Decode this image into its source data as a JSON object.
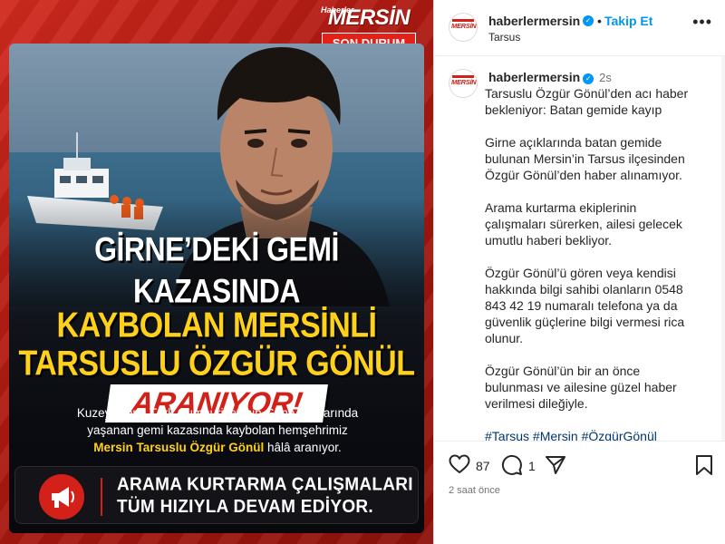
{
  "post_image": {
    "brand_small": "Haberler",
    "brand_name": "MERSİN",
    "brand_badge": "SON DURUM",
    "headline": {
      "line1": "GİRNE’DEKİ GEMİ KAZASINDA",
      "line2": "KAYBOLAN MERSİNLİ",
      "line3": "TARSUSLU ÖZGÜR GÖNÜL",
      "line4": "ARANIYOR!"
    },
    "description": {
      "line1": "Kuzey Kıbrıs Türk Cumhuriyeti’nin Girne açıklarında",
      "line2": "yaşanan gemi kazasında kaybolan hemşehrimiz",
      "highlight": "Mersin Tarsuslu Özgür Gönül",
      "line3_rest": " hâlâ aranıyor."
    },
    "alert": {
      "icon": "megaphone-icon",
      "line1": "ARAMA KURTARMA ÇALIŞMALARI",
      "line2": "TÜM HIZIYLA DEVAM EDİYOR."
    }
  },
  "header": {
    "username": "haberlermersin",
    "follow_label": "Takip Et",
    "location": "Tarsus",
    "separator": "•",
    "avatar_text": "MERSİN"
  },
  "caption": {
    "username": "haberlermersin",
    "time": "2s",
    "paragraphs": [
      "Tarsuslu Özgür Gönül’den acı haber bekleniyor: Batan gemide kayıp",
      "Girne açıklarında batan gemide bulunan Mersin’in Tarsus ilçesinden Özgür Gönül’den haber alınamıyor.",
      "Arama kurtarma ekiplerinin çalışmaları sürerken, ailesi gelecek umutlu haberi bekliyor.",
      "Özgür Gönül’ü gören veya kendisi hakkında bilgi sahibi olanların 0548 843 42 19 numaralı telefona ya da güvenlik güçlerine bilgi vermesi rica olunur.",
      "Özgür Gönül’ün bir an önce bulunması ve ailesine güzel haber verilmesi dileğiyle."
    ],
    "hashtags": "#Tarsus #Mersin #ÖzgürGönül #Kıbrıs #Girne #Kayıp #Haberlermersin"
  },
  "actions": {
    "like_count": "87",
    "comment_count": "1",
    "post_time": "2 saat önce"
  },
  "colors": {
    "brand_red": "#d3211a",
    "headline_yellow": "#ffd11a",
    "link_blue": "#0095f6",
    "hashtag_blue": "#00376b",
    "verified_blue": "#0095f6"
  }
}
